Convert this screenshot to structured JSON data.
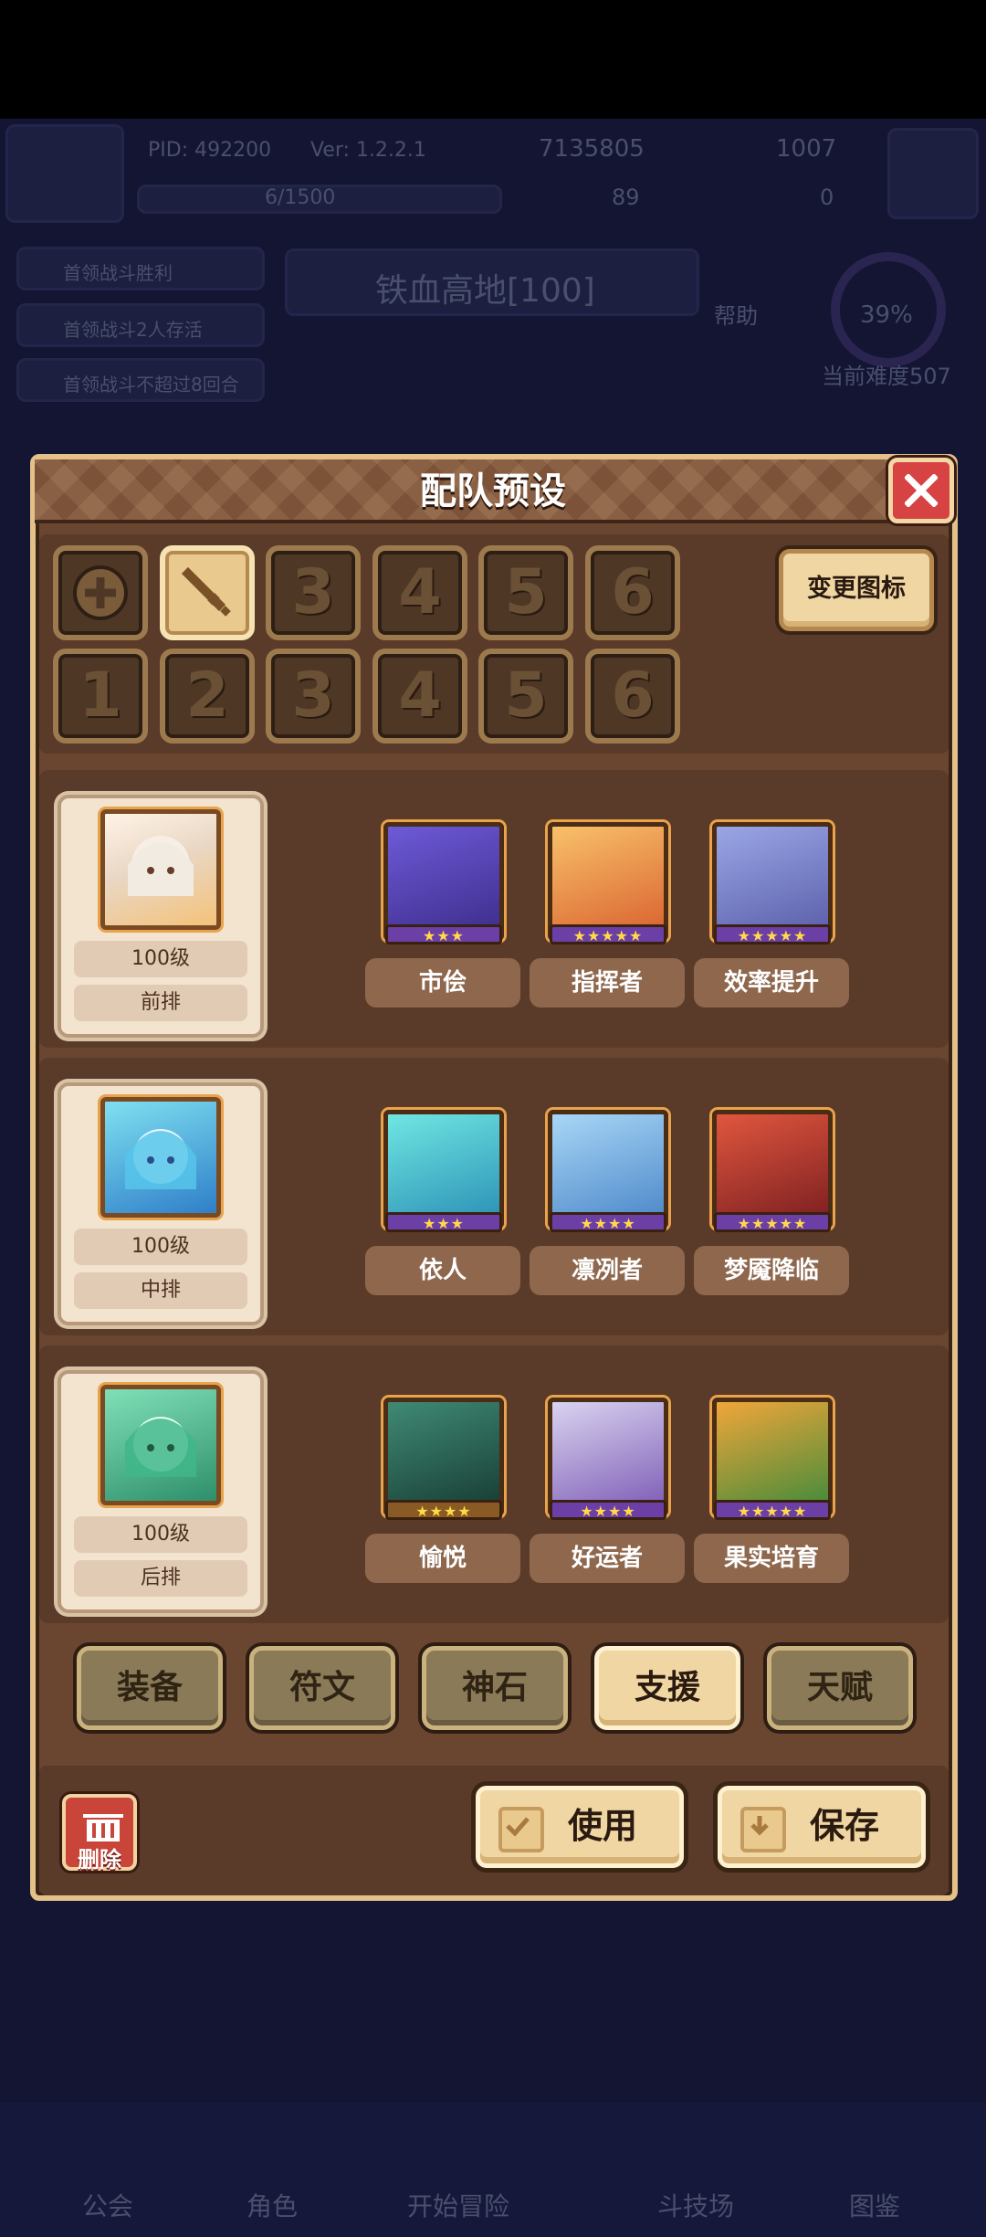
{
  "background": {
    "pid": "PID: 492200",
    "version": "Ver: 1.2.2.1",
    "gold": "7135805",
    "gems": "1007",
    "energy": "6/1500",
    "clover": "89",
    "keys": "0",
    "quests": [
      "首领战斗胜利",
      "首领战斗2人存活",
      "首领战斗不超过8回合"
    ],
    "stage_name": "铁血高地[100]",
    "help": "帮助",
    "progress": "39%",
    "difficulty": "当前难度507",
    "nav": [
      "公会",
      "角色",
      "开始冒险",
      "斗技场",
      "图鉴"
    ]
  },
  "modal": {
    "title": "配队预设",
    "change_icon_label": "变更图标",
    "top_slots": [
      "",
      "",
      "3",
      "4",
      "5",
      "6"
    ],
    "bottom_slots": [
      "1",
      "2",
      "3",
      "4",
      "5",
      "6"
    ],
    "rows": [
      {
        "level": "100级",
        "position": "前排",
        "cards": [
          {
            "name": "市侩",
            "stars": "★★★"
          },
          {
            "name": "指挥者",
            "stars": "★★★★★"
          },
          {
            "name": "效率提升",
            "stars": "★★★★★"
          }
        ]
      },
      {
        "level": "100级",
        "position": "中排",
        "cards": [
          {
            "name": "依人",
            "stars": "★★★"
          },
          {
            "name": "凛冽者",
            "stars": "★★★★"
          },
          {
            "name": "梦魇降临",
            "stars": "★★★★★"
          }
        ]
      },
      {
        "level": "100级",
        "position": "后排",
        "cards": [
          {
            "name": "愉悦",
            "stars": "★★★★"
          },
          {
            "name": "好运者",
            "stars": "★★★★"
          },
          {
            "name": "果实培育",
            "stars": "★★★★★"
          }
        ]
      }
    ],
    "tabs": [
      "装备",
      "符文",
      "神石",
      "支援",
      "天赋"
    ],
    "active_tab": "支援",
    "delete_label": "删除",
    "use_label": "使用",
    "save_label": "保存"
  }
}
